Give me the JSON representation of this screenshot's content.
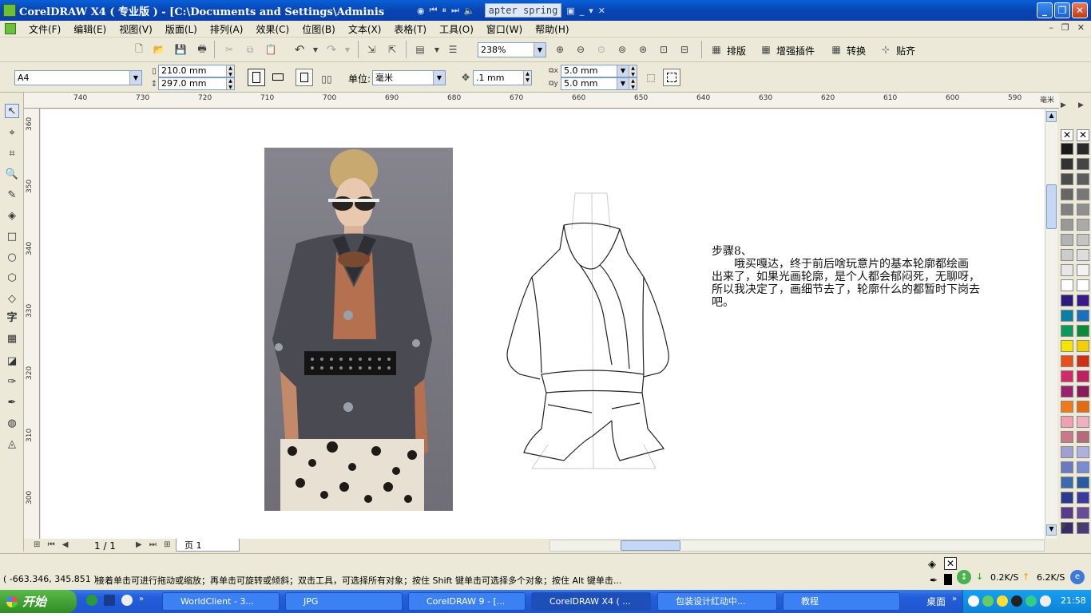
{
  "window": {
    "title": "CorelDRAW X4 ( 专业版 ) - [C:\\Documents and Settings\\Adminis"
  },
  "media": {
    "song": "apter spring"
  },
  "menu": {
    "items": [
      "文件(F)",
      "编辑(E)",
      "视图(V)",
      "版面(L)",
      "排列(A)",
      "效果(C)",
      "位图(B)",
      "文本(X)",
      "表格(T)",
      "工具(O)",
      "窗口(W)",
      "帮助(H)"
    ]
  },
  "toolbar": {
    "zoom": "238%",
    "plugins": [
      {
        "label": "排版"
      },
      {
        "label": "增强插件"
      },
      {
        "label": "转换"
      },
      {
        "label": "贴齐"
      }
    ]
  },
  "propbar": {
    "paper": "A4",
    "width": "210.0 mm",
    "height": "297.0 mm",
    "units_label": "单位:",
    "units": "毫米",
    "nudge": ".1 mm",
    "dup_x": "5.0 mm",
    "dup_y": "5.0 mm"
  },
  "ruler": {
    "h_ticks": [
      "740",
      "730",
      "720",
      "710",
      "700",
      "690",
      "680",
      "670",
      "660",
      "650",
      "640",
      "630",
      "620",
      "610",
      "600",
      "590"
    ],
    "h_unit": "毫米",
    "v_ticks": [
      "360",
      "350",
      "340",
      "330",
      "320",
      "310",
      "300"
    ]
  },
  "canvas": {
    "step_title": "步骤8、",
    "step_text": [
      "　　哦买嘎达，终于前后啥玩意片的基本轮廓都绘画",
      "出来了，如果光画轮廓，是个人都会郁闷死，无聊呀，",
      "所以我决定了，画细节去了，轮廓什么的都暂时下岗去",
      "吧。"
    ]
  },
  "page_nav": {
    "count": "1 / 1",
    "tab": "页 1"
  },
  "status": {
    "coords": "( -663.346, 345.851 )",
    "hint": "接着单击可进行拖动或缩放；再单击可旋转或倾斜；双击工具，可选择所有对象；按住 Shift 键单击可选择多个对象；按住 Alt 键单击...",
    "down_speed": "0.2K/S",
    "up_speed": "6.2K/S"
  },
  "palette": {
    "colors_left": [
      "#1a1a1a",
      "#333333",
      "#4d4d4d",
      "#666666",
      "#808080",
      "#999999",
      "#b3b3b3",
      "#cccccc",
      "#e6e6e6",
      "#ffffff",
      "#2e1a7a",
      "#0a7fa5",
      "#0a9a5a",
      "#f5e600",
      "#e8501a",
      "#d02a6a",
      "#9a2070",
      "#f07a1a",
      "#f0a0b0",
      "#c87a88",
      "#a0a0d0",
      "#6a7ac0",
      "#3a6ab0",
      "#2a3a90",
      "#5a3a8a",
      "#3a2a6a"
    ],
    "colors_right": [
      "#2a2a2a",
      "#444444",
      "#5d5d5d",
      "#777777",
      "#8f8f8f",
      "#aaaaaa",
      "#c4c4c4",
      "#dddddd",
      "#f2f2f2",
      "#ffffff",
      "#3a1a8a",
      "#1a70c0",
      "#0a8a3a",
      "#f0d000",
      "#d03010",
      "#c02060",
      "#8a1a5a",
      "#e86a10",
      "#f0b0c0",
      "#b86a7a",
      "#b0b0e0",
      "#7a8ad0",
      "#2a5aa0",
      "#3a3aa0",
      "#6a4a9a",
      "#4a3a7a"
    ]
  },
  "taskbar": {
    "start": "开始",
    "tasks": [
      "WorldClient - 3...",
      "JPG",
      "CorelDRAW 9 - [...",
      "CorelDRAW X4 ( ...",
      "包装设计红动中...",
      "教程"
    ],
    "desktop": "桌面",
    "time": "21:58"
  }
}
